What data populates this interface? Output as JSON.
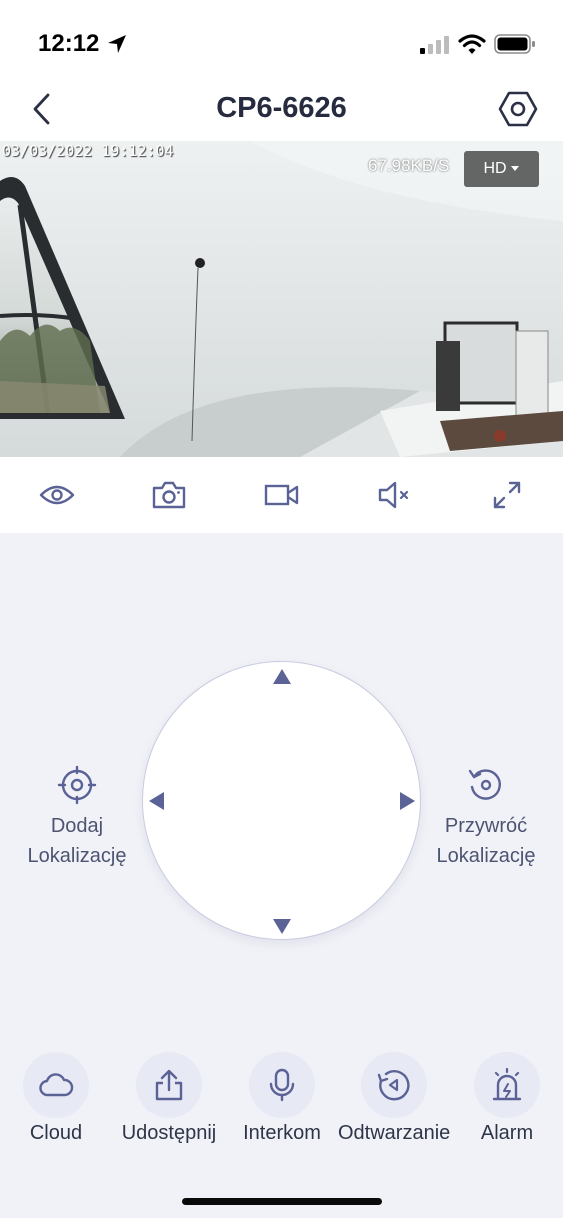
{
  "status_bar": {
    "time": "12:12"
  },
  "nav": {
    "title": "CP6-6626"
  },
  "video": {
    "timestamp": "03/03/2022 19:12:04",
    "bitrate": "67.98KB/S",
    "quality": "HD"
  },
  "controls": {
    "icons": [
      "eye-icon",
      "camera-icon",
      "video-record-icon",
      "speaker-muted-icon",
      "fullscreen-icon"
    ]
  },
  "ptz": {
    "left_action": [
      "Dodaj",
      "Lokalizację"
    ],
    "right_action": [
      "Przywróć",
      "Lokalizację"
    ]
  },
  "actions": [
    {
      "label": "Cloud",
      "icon": "cloud-icon"
    },
    {
      "label": "Udostępnij",
      "icon": "share-icon"
    },
    {
      "label": "Interkom",
      "icon": "microphone-icon"
    },
    {
      "label": "Odtwarzanie",
      "icon": "playback-icon"
    },
    {
      "label": "Alarm",
      "icon": "alarm-icon"
    }
  ],
  "colors": {
    "accent": "#5b6396",
    "background": "#f1f2f7",
    "action_circle": "#e7e9f5"
  }
}
